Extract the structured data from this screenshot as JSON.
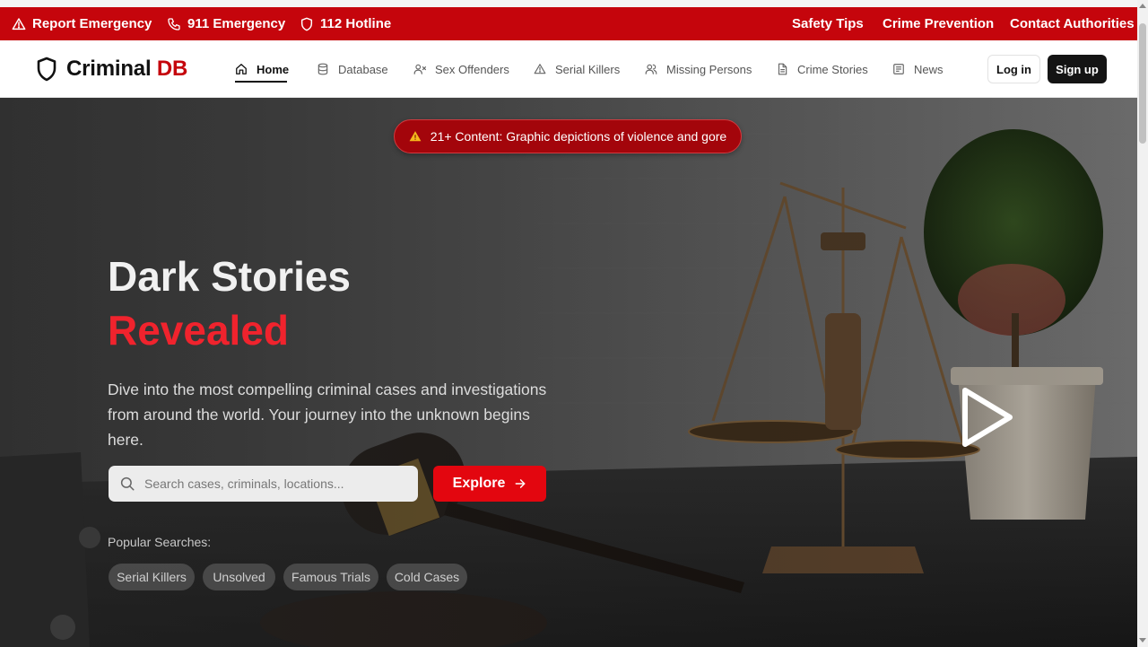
{
  "emergency_bar": {
    "left_items": [
      {
        "label": "Report Emergency",
        "icon": "alert-triangle-icon"
      },
      {
        "label": "911 Emergency",
        "icon": "phone-icon"
      },
      {
        "label": "112 Hotline",
        "icon": "shield-icon"
      }
    ],
    "right_items": [
      {
        "label": "Safety Tips"
      },
      {
        "label": "Crime Prevention"
      },
      {
        "label": "Contact Authorities"
      }
    ],
    "color": "#c5050c"
  },
  "navbar": {
    "logo": {
      "text_main": "Criminal",
      "text_accent": "DB",
      "icon": "shield-icon"
    },
    "items": [
      {
        "label": "Home",
        "icon": "home-icon",
        "active": true
      },
      {
        "label": "Database",
        "icon": "database-icon",
        "active": false
      },
      {
        "label": "Sex Offenders",
        "icon": "user-x-icon",
        "active": false
      },
      {
        "label": "Serial Killers",
        "icon": "alert-triangle-icon",
        "active": false
      },
      {
        "label": "Missing Persons",
        "icon": "users-icon",
        "active": false
      },
      {
        "label": "Crime Stories",
        "icon": "file-text-icon",
        "active": false
      },
      {
        "label": "News",
        "icon": "newspaper-icon",
        "active": false
      }
    ],
    "login_label": "Log in",
    "signup_label": "Sign up"
  },
  "hero": {
    "warning": "21+ Content: Graphic depictions of violence and gore",
    "title_line1": "Dark Stories",
    "title_line2": "Revealed",
    "description": "Dive into the most compelling criminal cases and investigations from around the world. Your journey into the unknown begins here.",
    "search": {
      "placeholder": "Search cases, criminals, locations...",
      "value": ""
    },
    "explore_label": "Explore",
    "popular_label": "Popular Searches:",
    "popular_chips": [
      "Serial Killers",
      "Unsolved",
      "Famous Trials",
      "Cold Cases"
    ],
    "accent_color": "#e3060f"
  }
}
